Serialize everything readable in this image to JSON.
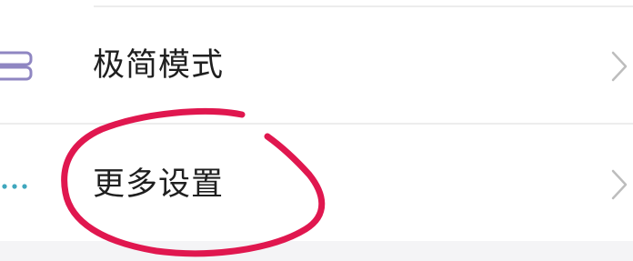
{
  "menu": {
    "items": [
      {
        "label": "极简模式",
        "icon": "list-icon",
        "trailing_icon": "chevron-right-icon"
      },
      {
        "label": "更多设置",
        "icon": "more-dots-icon",
        "trailing_icon": "chevron-right-icon"
      }
    ]
  },
  "colors": {
    "text": "#1f1f1f",
    "icon_purple": "#8f86c2",
    "icon_teal": "#3fa7be",
    "chevron": "#bdbdbd",
    "annotation_stroke": "#e0174f",
    "divider": "#ededed"
  }
}
